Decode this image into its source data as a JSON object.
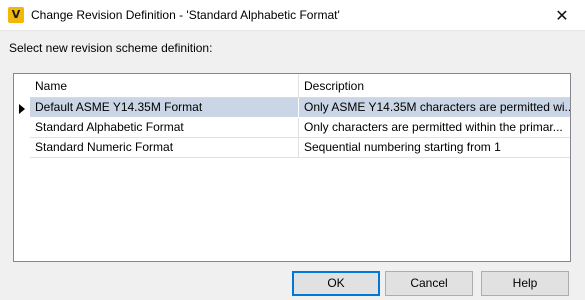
{
  "window": {
    "icon_letter": "V",
    "title": "Change Revision Definition - 'Standard Alphabetic Format'",
    "close_glyph": "✕"
  },
  "prompt": "Select new revision scheme definition:",
  "table": {
    "columns": [
      "Name",
      "Description"
    ],
    "rows": [
      {
        "name": "Default ASME Y14.35M Format",
        "description": "Only ASME Y14.35M characters are permitted wi..."
      },
      {
        "name": "Standard Alphabetic Format",
        "description": "Only characters are permitted within the primar..."
      },
      {
        "name": "Standard Numeric Format",
        "description": "Sequential numbering starting from 1"
      }
    ],
    "selected_index": 0
  },
  "buttons": {
    "ok": "OK",
    "cancel": "Cancel",
    "help": "Help"
  },
  "colors": {
    "selection": "#cad6e6",
    "focus_border": "#0078d7",
    "app_icon": "#f2b707"
  }
}
